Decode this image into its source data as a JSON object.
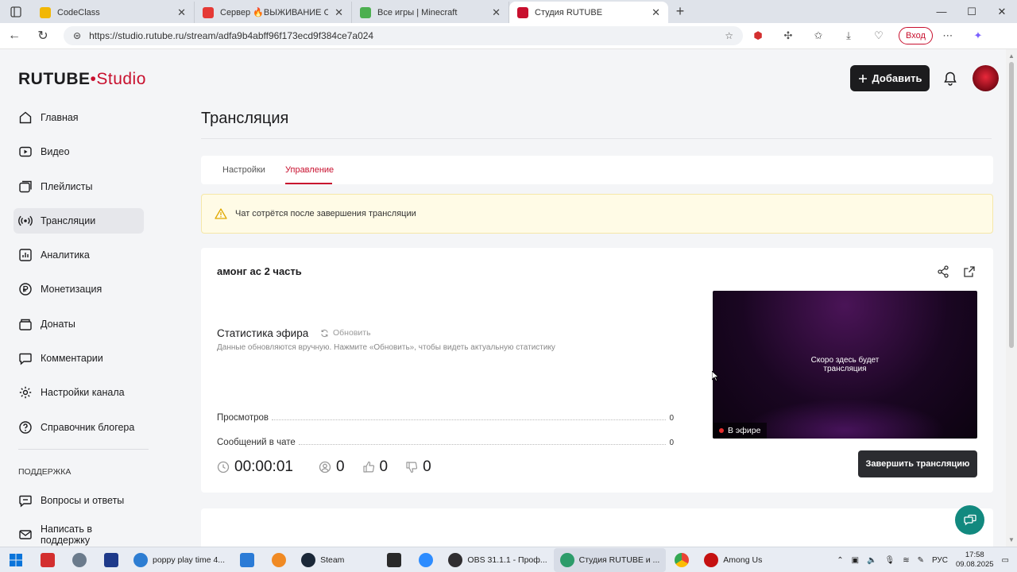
{
  "browser": {
    "tabs": [
      {
        "title": "CodeClass",
        "color": "#f2b705"
      },
      {
        "title": "Сервер 🔥ВЫЖИВАНИЕ ОДИН",
        "color": "#e53935"
      },
      {
        "title": "Все игры | Minecraft",
        "color": "#4caf50"
      },
      {
        "title": "Студия RUTUBE",
        "color": "#c8102e",
        "active": true
      }
    ],
    "url": "https://studio.rutube.ru/stream/adfa9b4abff96f173ecd9f384ce7a024",
    "login_label": "Вход"
  },
  "header": {
    "logo_main": "RUTUBE",
    "logo_studio": "Studio",
    "add_label": "Добавить"
  },
  "sidebar": {
    "items": [
      {
        "label": "Главная",
        "icon": "home-icon"
      },
      {
        "label": "Видео",
        "icon": "video-icon"
      },
      {
        "label": "Плейлисты",
        "icon": "playlist-icon"
      },
      {
        "label": "Трансляции",
        "icon": "broadcast-icon",
        "active": true
      },
      {
        "label": "Аналитика",
        "icon": "analytics-icon"
      },
      {
        "label": "Монетизация",
        "icon": "monetization-icon"
      },
      {
        "label": "Донаты",
        "icon": "donate-icon"
      },
      {
        "label": "Комментарии",
        "icon": "comments-icon"
      },
      {
        "label": "Настройки канала",
        "icon": "gear-icon"
      },
      {
        "label": "Справочник блогера",
        "icon": "help-icon"
      }
    ],
    "support_title": "ПОДДЕРЖКА",
    "support_items": [
      {
        "label": "Вопросы и ответы"
      },
      {
        "label": "Написать в поддержку"
      }
    ]
  },
  "main": {
    "page_title": "Трансляция",
    "tabs": [
      {
        "label": "Настройки"
      },
      {
        "label": "Управление",
        "active": true
      }
    ],
    "warning": "Чат сотрётся после завершения трансляции",
    "stream_name": "амонг ас 2 часть",
    "stats": {
      "title": "Статистика эфира",
      "refresh": "Обновить",
      "note": "Данные обновляются вручную. Нажмите «Обновить», чтобы видеть актуальную статистику",
      "rows": [
        {
          "label": "Просмотров",
          "value": "0"
        },
        {
          "label": "Сообщений в чате",
          "value": "0"
        }
      ]
    },
    "player": {
      "message_line1": "Скоро здесь будет",
      "message_line2": "трансляция",
      "live_label": "В эфире"
    },
    "metrics": {
      "timer": "00:00:01",
      "viewers": "0",
      "likes": "0",
      "dislikes": "0"
    },
    "end_button": "Завершить трансляцию"
  },
  "taskbar": {
    "apps": [
      {
        "label": "poppy play time 4...",
        "color": "#2d7dd2"
      },
      {
        "label": "Steam",
        "color": "#1b2838"
      },
      {
        "label": "OBS 31.1.1 - Проф...",
        "color": "#302e31"
      },
      {
        "label": "Студия RUTUBE и ...",
        "color": "#2d9c6a",
        "active": true
      },
      {
        "label": "Among Us",
        "color": "#c51111"
      }
    ],
    "lang": "РУС",
    "time": "17:58",
    "date": "09.08.2025"
  }
}
